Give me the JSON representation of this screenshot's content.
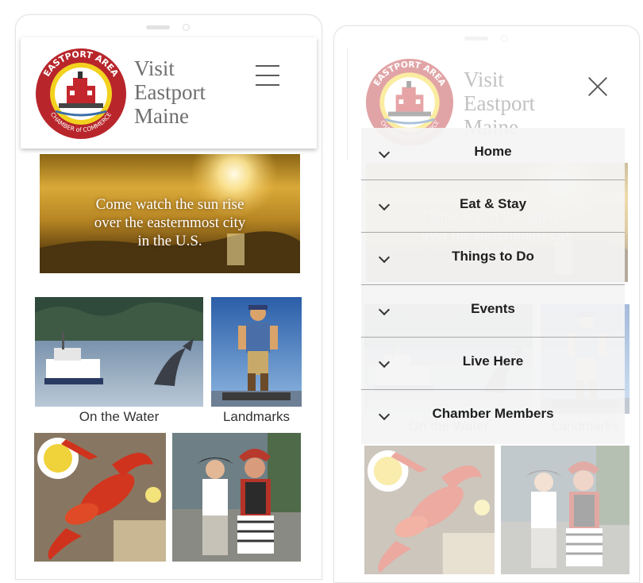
{
  "site": {
    "title_lines": [
      "Visit",
      "Eastport",
      "Maine"
    ],
    "logo_top_text": "EASTPORT AREA",
    "logo_bottom_text": "CHAMBER of COMMERCE"
  },
  "hero": {
    "lines": [
      "Come watch the sun rise",
      "over the easternmost city",
      "in the U.S."
    ]
  },
  "tiles": [
    {
      "label": "On the Water"
    },
    {
      "label": "Landmarks"
    },
    {
      "label": ""
    },
    {
      "label": ""
    }
  ],
  "menu": {
    "items": [
      {
        "label": "Home"
      },
      {
        "label": "Eat & Stay"
      },
      {
        "label": "Things to Do"
      },
      {
        "label": "Events"
      },
      {
        "label": "Live Here"
      },
      {
        "label": "Chamber Members"
      }
    ]
  },
  "icons": {
    "menu_open": "hamburger-icon",
    "menu_close": "close-icon",
    "submenu": "chevron-down-icon"
  },
  "colors": {
    "logo_red": "#b8262b",
    "logo_yellow": "#f2d21f",
    "title_gray": "#6f6f6f",
    "menu_bg": "#f4f4f4"
  }
}
